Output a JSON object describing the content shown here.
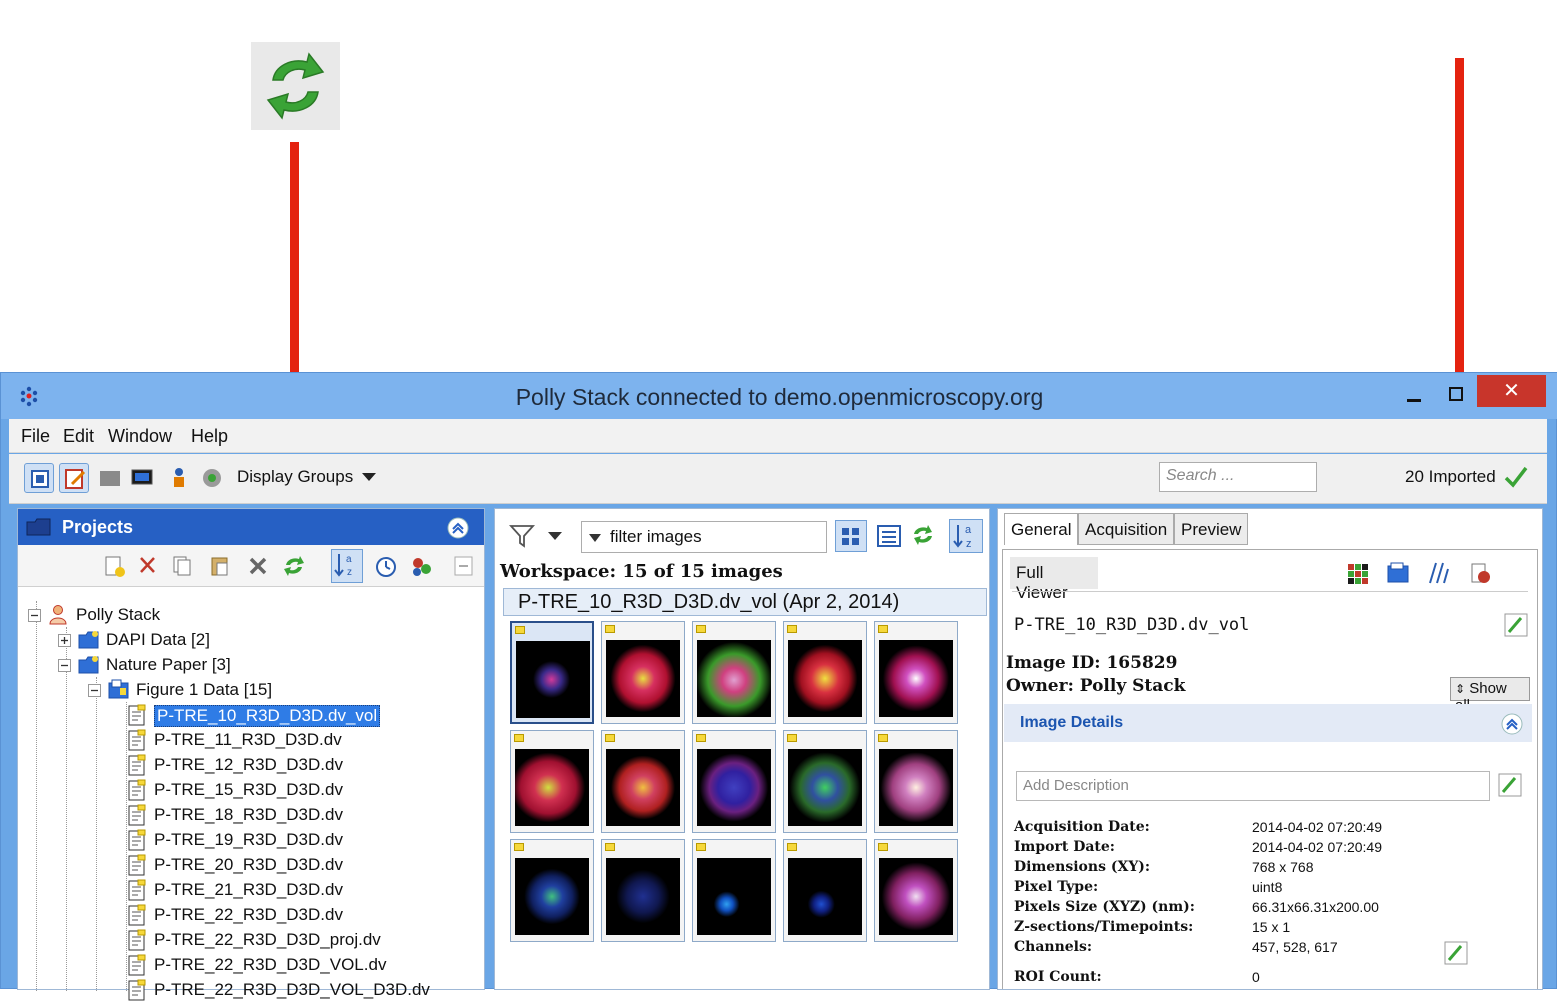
{
  "window": {
    "title": "Polly Stack connected to demo.openmicroscopy.org",
    "close_glyph": "✕"
  },
  "menu": {
    "items": [
      "File",
      "Edit",
      "Window",
      "Help"
    ]
  },
  "toolbar": {
    "display_groups_label": "Display Groups",
    "search_placeholder": "Search ...",
    "imported_status": "20 Imported"
  },
  "left_panel": {
    "header": "Projects",
    "tree": [
      {
        "label": "Polly Stack",
        "icon": "user-icon"
      },
      {
        "label": "DAPI Data [2]",
        "icon": "project-folder-icon"
      },
      {
        "label": "Nature Paper [3]",
        "icon": "project-folder-icon"
      },
      {
        "label": "Figure 1 Data [15]",
        "icon": "dataset-icon"
      },
      {
        "label": "P-TRE_10_R3D_D3D.dv_vol",
        "icon": "image-file-icon",
        "selected": true
      },
      {
        "label": "P-TRE_11_R3D_D3D.dv",
        "icon": "image-file-icon"
      },
      {
        "label": "P-TRE_12_R3D_D3D.dv",
        "icon": "image-file-icon"
      },
      {
        "label": "P-TRE_15_R3D_D3D.dv",
        "icon": "image-file-icon"
      },
      {
        "label": "P-TRE_18_R3D_D3D.dv",
        "icon": "image-file-icon"
      },
      {
        "label": "P-TRE_19_R3D_D3D.dv",
        "icon": "image-file-icon"
      },
      {
        "label": "P-TRE_20_R3D_D3D.dv",
        "icon": "image-file-icon"
      },
      {
        "label": "P-TRE_21_R3D_D3D.dv",
        "icon": "image-file-icon"
      },
      {
        "label": "P-TRE_22_R3D_D3D.dv",
        "icon": "image-file-icon"
      },
      {
        "label": "P-TRE_22_R3D_D3D_proj.dv",
        "icon": "image-file-icon"
      },
      {
        "label": "P-TRE_22_R3D_D3D_VOL.dv",
        "icon": "image-file-icon"
      },
      {
        "label": "P-TRE_22_R3D_D3D_VOL_D3D.dv",
        "icon": "image-file-icon"
      }
    ]
  },
  "middle_panel": {
    "filter_label": "filter images",
    "workspace_status": "Workspace: 15 of 15 images",
    "dataset_title": "P-TRE_10_R3D_D3D.dv_vol (Apr 2, 2014)",
    "thumbnail_count": 15
  },
  "right_panel": {
    "tabs": [
      "General",
      "Acquisition",
      "Preview"
    ],
    "active_tab": "General",
    "full_viewer_label": "Full Viewer",
    "image_name": "P-TRE_10_R3D_D3D.dv_vol",
    "image_id": "Image ID: 165829",
    "owner": "Owner: Polly Stack",
    "show_all_label": "Show all",
    "image_details_label": "Image Details",
    "description_placeholder": "Add Description",
    "details": [
      {
        "key": "Acquisition Date:",
        "value": "2014-04-02 07:20:49"
      },
      {
        "key": "Import Date:",
        "value": "2014-04-02 07:20:49"
      },
      {
        "key": "Dimensions (XY):",
        "value": "768 x 768"
      },
      {
        "key": "Pixel Type:",
        "value": "uint8"
      },
      {
        "key": "Pixels Size (XYZ) (nm):",
        "value": "66.31x66.31x200.00"
      },
      {
        "key": "Z-sections/Timepoints:",
        "value": "15 x 1"
      },
      {
        "key": "Channels:",
        "value": "457, 528, 617"
      },
      {
        "key": "ROI Count:",
        "value": "0"
      }
    ]
  },
  "colors": {
    "arrow": "#e4220f",
    "title_bar": "#7db3ee",
    "projects_header": "#2660c4",
    "selection": "#2f7ce6",
    "refresh_green": "#3aa336"
  }
}
